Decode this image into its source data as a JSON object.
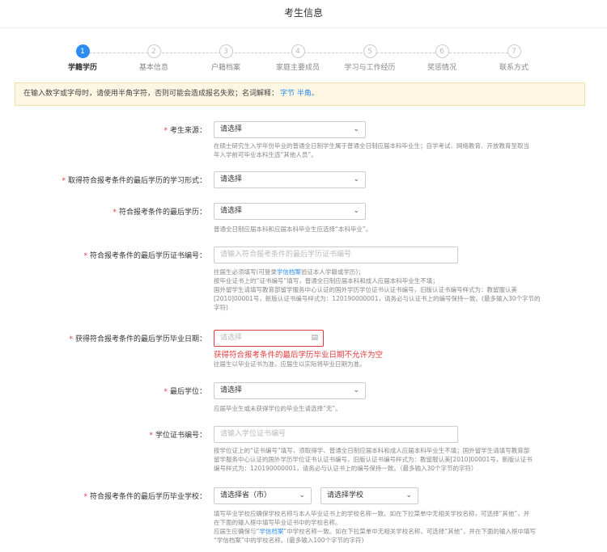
{
  "page": {
    "title": "考生信息"
  },
  "steps": [
    {
      "num": "1",
      "label": "学籍学历",
      "active": true
    },
    {
      "num": "2",
      "label": "基本信息",
      "active": false
    },
    {
      "num": "3",
      "label": "户籍档案",
      "active": false
    },
    {
      "num": "4",
      "label": "家庭主要成员",
      "active": false
    },
    {
      "num": "5",
      "label": "学习与工作经历",
      "active": false
    },
    {
      "num": "6",
      "label": "奖惩情况",
      "active": false
    },
    {
      "num": "7",
      "label": "联系方式",
      "active": false
    }
  ],
  "notice": {
    "text": "在输入数字或字母时，请使用半角字符，否则可能会造成报名失败；名词解释：",
    "link": "字节 半角。"
  },
  "form": {
    "source": {
      "label": "考生来源：",
      "value": "请选择",
      "hint1": "在硕士研究生入学年份毕业的普通全日制学生属于普通全日制应届本科毕业生；自学考试、网络教育、开放教育至取当",
      "hint2": "年入学前可毕业本科生选“其他人员”。"
    },
    "study_form": {
      "label": "取得符合报考条件的最后学历的学习形式：",
      "value": "请选择"
    },
    "last_degree_edu": {
      "label": "符合报考条件的最后学历：",
      "value": "请选择",
      "hint": "普通全日制应届本科和应届本科毕业生应选择“本科毕业”。"
    },
    "cert_no": {
      "label": "符合报考条件的最后学历证书编号：",
      "placeholder": "请输入符合报考条件的最后学历证书编号",
      "hint1a": "往届生必须填写(可登录",
      "hint1_link": "学信档案",
      "hint1b": "验证本人学籍或学历)；",
      "hint2": "按毕业证书上的“证书编号”填写，普通全日制应届本科和成人应届本科毕业生不填；",
      "hint3": "国外留学生请填写教育部留学服务中心认证的国外学历学位证书认证书编号，旧版认证书编号样式为：教留服认美",
      "hint4": "[2010]00001号，新版认证书编号样式为：120190000001，请务必与认证书上的编号保持一致。(最多输入30个字节的",
      "hint5": "字符)"
    },
    "grad_date": {
      "label": "获得符合报考条件的最后学历毕业日期：",
      "placeholder": "请选择",
      "error": "获得符合报考条件的最后学历毕业日期不允许为空",
      "hint": "往届生以毕业证书为准，应届生以实际将毕业日期为准。"
    },
    "last_degree": {
      "label": "最后学位：",
      "value": "请选择",
      "hint": "应届毕业生或未获得学位的毕业生请选择“无”。"
    },
    "degree_cert": {
      "label": "学位证书编号：",
      "placeholder": "请输入学位证书编号",
      "hint1": "按学位证上的“证书编号”填写，须取得学、普通全日制应届本科和成人应届本科毕业生不填；国外留学生请填写教育部",
      "hint2": "留学服务中心认证的国外学历学位证书认证书编号，旧版认证书编号样式为：教留服认美[2010]00001号，新版认证书",
      "hint3": "编号样式为：120190000001，请务必与认证书上的编号保持一致。（最多输入30个字节的字符）"
    },
    "school": {
      "label": "符合报考条件的最后学历毕业学校：",
      "province": "请选择省（市）",
      "school": "请选择学校",
      "hint1": "填写毕业学校应确保学校名称与本人毕业证书上的学校名称一致。如在下拉菜单中无相关学校名称，可选择“其他”，并",
      "hint2": "在下面的输入框中填写毕业证书中的学校名称。",
      "hint3a": "应届生应确保与“",
      "hint3_link": "学信档案",
      "hint3b": "”中学校名称一致。如在下拉菜单中无相关学校名称，可选择“其他”，并在下面的输入框中填写",
      "hint4": "“学信档案”中的学校名称。(最多输入100个字节的字符)"
    }
  }
}
